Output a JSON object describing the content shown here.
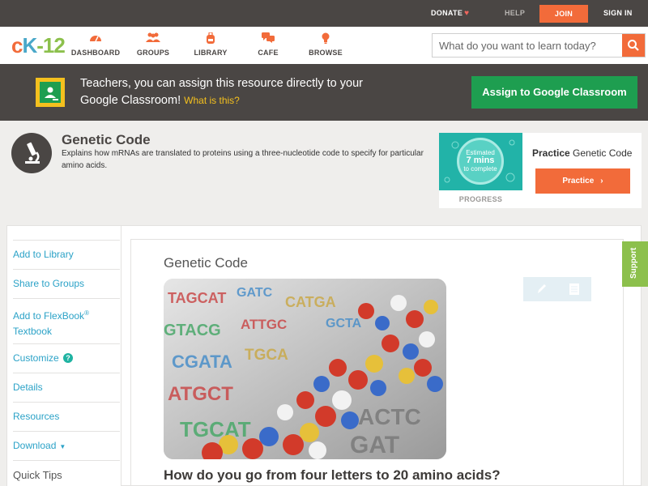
{
  "topbar": {
    "donate_label": "DONATE",
    "help_label": "HELP",
    "join_label": "JOIN",
    "signin_label": "SIGN IN"
  },
  "brand": {
    "logo_c": "c",
    "logo_k": "K",
    "logo_dash": "-",
    "logo_num": "12"
  },
  "nav": {
    "items": [
      {
        "label": "DASHBOARD",
        "icon": "gauge-icon"
      },
      {
        "label": "GROUPS",
        "icon": "people-icon"
      },
      {
        "label": "LIBRARY",
        "icon": "backpack-icon"
      },
      {
        "label": "CAFE",
        "icon": "chat-icon"
      },
      {
        "label": "BROWSE",
        "icon": "lightbulb-icon"
      }
    ],
    "search_placeholder": "What do you want to learn today?"
  },
  "banner": {
    "text": "Teachers, you can assign this resource directly to your Google Classroom!",
    "link": "What is this?",
    "button": "Assign to Google Classroom"
  },
  "concept": {
    "title": "Genetic Code",
    "description": "Explains how mRNAs are translated to proteins using a three-nucleotide code to specify for particular amino acids."
  },
  "practice": {
    "estimate_line1": "Estimated",
    "estimate_line2": "7 mins",
    "estimate_line3": "to complete",
    "progress_label": "PROGRESS",
    "heading_bold": "Practice",
    "heading_rest": "Genetic Code",
    "button": "Practice"
  },
  "sidebar": {
    "add_library": "Add to Library",
    "share_groups": "Share to Groups",
    "add_flexbook": "Add to FlexBook",
    "add_flexbook_mark": "®",
    "add_flexbook_2": "Textbook",
    "customize": "Customize",
    "customize_help": "?",
    "details": "Details",
    "resources": "Resources",
    "download": "Download",
    "quick_tips": "Quick Tips"
  },
  "article": {
    "title": "Genetic Code",
    "question": "How do you go from four letters to 20 amino acids?"
  },
  "support": {
    "label": "Support"
  },
  "colors": {
    "orange": "#f26b3a",
    "dark": "#4a4644",
    "green": "#1e9e50",
    "link": "#2ba2c7",
    "support": "#8cc04c"
  }
}
